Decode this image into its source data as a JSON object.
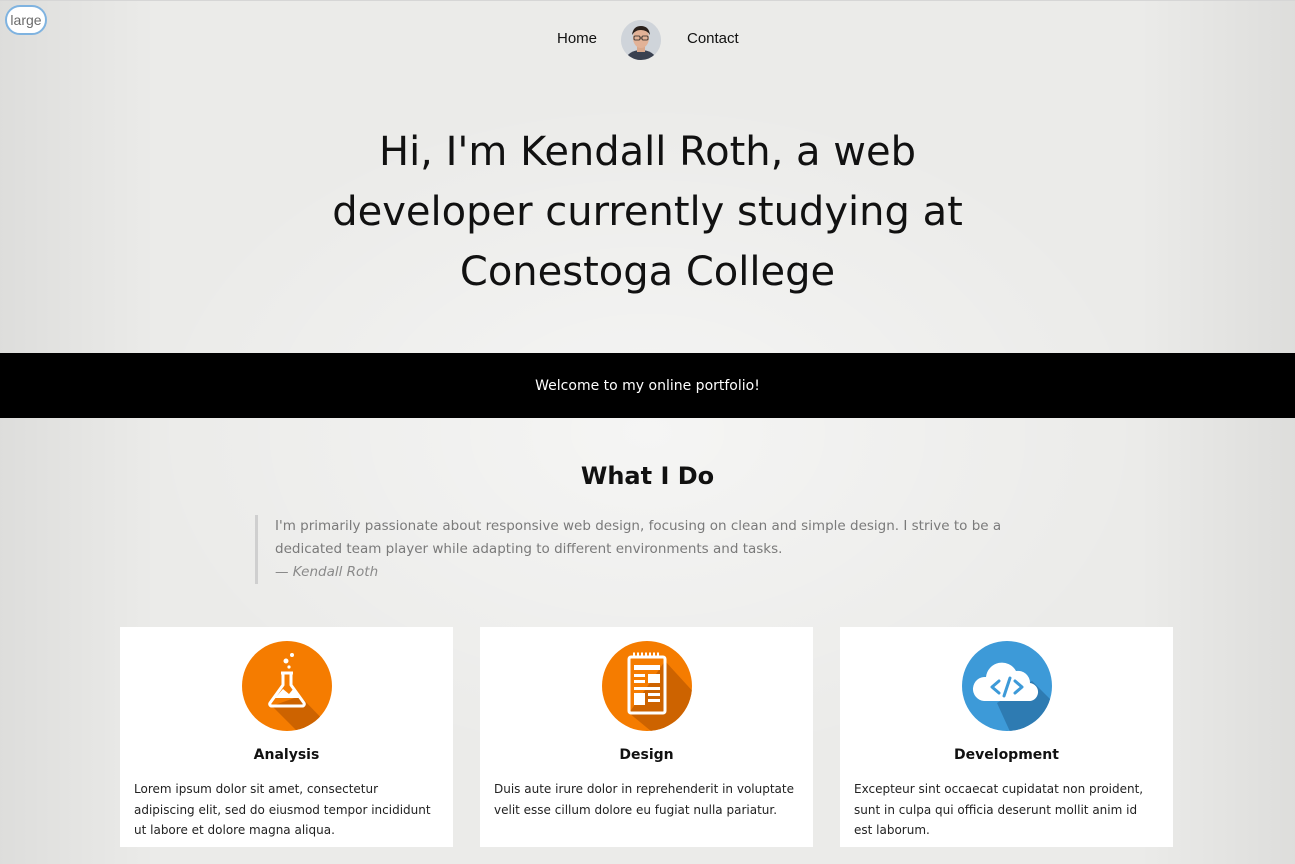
{
  "badge": "large",
  "nav": {
    "home": "Home",
    "contact": "Contact"
  },
  "hero": {
    "title": "Hi, I'm Kendall Roth, a web developer currently studying at Conestoga College"
  },
  "banner": {
    "text": "Welcome to my online portfolio!"
  },
  "what_i_do": {
    "title": "What I Do",
    "quote": "I'm primarily passionate about responsive web design, focusing on clean and simple design. I strive to be a dedicated team player while adapting to different environments and tasks.",
    "author": "— Kendall Roth"
  },
  "cards": [
    {
      "title": "Analysis",
      "icon": "flask-icon",
      "color": "#f57c00",
      "text": "Lorem ipsum dolor sit amet, consectetur adipiscing elit, sed do eiusmod tempor incididunt ut labore et dolore magna aliqua."
    },
    {
      "title": "Design",
      "icon": "layout-notepad-icon",
      "color": "#f57c00",
      "text": "Duis aute irure dolor in reprehenderit in voluptate velit esse cillum dolore eu fugiat nulla pariatur."
    },
    {
      "title": "Development",
      "icon": "cloud-code-icon",
      "color": "#3d9ad8",
      "text": "Excepteur sint occaecat cupidatat non proident, sunt in culpa qui officia deserunt mollit anim id est laborum."
    }
  ]
}
